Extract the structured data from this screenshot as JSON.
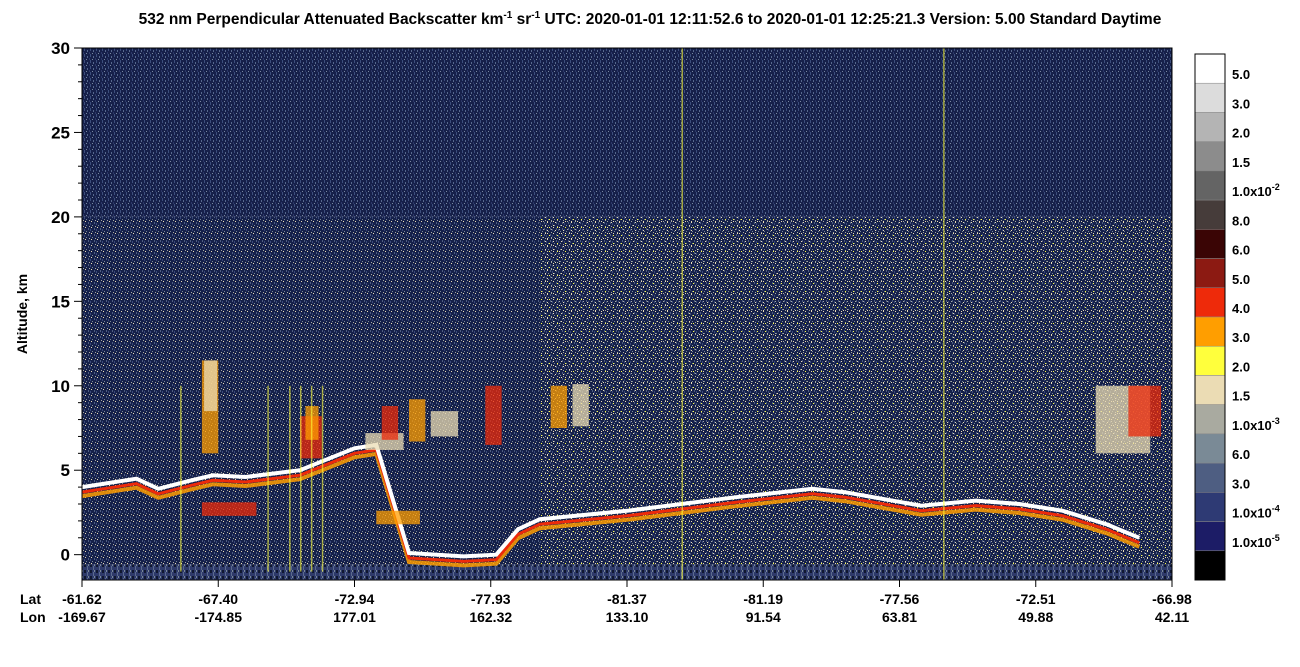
{
  "title": {
    "prefix": "532 nm Perpendicular Attenuated Backscatter km",
    "sup1": "-1",
    "middle": " sr",
    "sup2": "-1",
    "suffix": "  UTC: 2020-01-01 12:11:52.6 to 2020-01-01 12:25:21.3  Version: 5.00 Standard Daytime"
  },
  "chart_data": {
    "type": "heatmap",
    "ylabel": "Altitude, km",
    "ylim": [
      -1.5,
      30
    ],
    "y_ticks": [
      "0",
      "5",
      "10",
      "15",
      "20",
      "25",
      "30"
    ],
    "x_row_labels": [
      "Lat",
      "Lon"
    ],
    "x_ticks": [
      {
        "lat": "-61.62",
        "lon": "-169.67"
      },
      {
        "lat": "-67.40",
        "lon": "-174.85"
      },
      {
        "lat": "-72.94",
        "lon": "177.01"
      },
      {
        "lat": "-77.93",
        "lon": "162.32"
      },
      {
        "lat": "-81.37",
        "lon": "133.10"
      },
      {
        "lat": "-81.19",
        "lon": "91.54"
      },
      {
        "lat": "-77.56",
        "lon": "63.81"
      },
      {
        "lat": "-72.51",
        "lon": "49.88"
      },
      {
        "lat": "-66.98",
        "lon": "42.11"
      }
    ],
    "colorbar": [
      {
        "label": "5.0",
        "color": "#ffffff"
      },
      {
        "label": "3.0",
        "color": "#dcdcdc"
      },
      {
        "label": "2.0",
        "color": "#b4b4b4"
      },
      {
        "label": "1.5",
        "color": "#8c8c8c"
      },
      {
        "label": "1.0x10",
        "exp": "-2",
        "color": "#646464"
      },
      {
        "label": "8.0",
        "color": "#463c3a"
      },
      {
        "label": "6.0",
        "color": "#3a0505"
      },
      {
        "label": "5.0",
        "color": "#8c1a12"
      },
      {
        "label": "4.0",
        "color": "#ee2a0a"
      },
      {
        "label": "3.0",
        "color": "#ff9e00"
      },
      {
        "label": "2.0",
        "color": "#ffff3c"
      },
      {
        "label": "1.5",
        "color": "#ebdcb4"
      },
      {
        "label": "1.0x10",
        "exp": "-3",
        "color": "#a9aaa0"
      },
      {
        "label": "6.0",
        "color": "#7a8a96"
      },
      {
        "label": "3.0",
        "color": "#4e5e82"
      },
      {
        "label": "1.0x10",
        "exp": "-4",
        "color": "#2e3a74"
      },
      {
        "label": "1.0x10",
        "exp": "-5",
        "color": "#1c1c66"
      },
      {
        "label": "",
        "color": "#000000"
      }
    ],
    "surface_profile": [
      {
        "x": 0.0,
        "alt": 4.0
      },
      {
        "x": 0.05,
        "alt": 4.5
      },
      {
        "x": 0.07,
        "alt": 3.9
      },
      {
        "x": 0.1,
        "alt": 4.4
      },
      {
        "x": 0.12,
        "alt": 4.7
      },
      {
        "x": 0.15,
        "alt": 4.6
      },
      {
        "x": 0.2,
        "alt": 5.0
      },
      {
        "x": 0.25,
        "alt": 6.3
      },
      {
        "x": 0.27,
        "alt": 6.5
      },
      {
        "x": 0.3,
        "alt": 0.1
      },
      {
        "x": 0.35,
        "alt": -0.1
      },
      {
        "x": 0.38,
        "alt": 0.0
      },
      {
        "x": 0.4,
        "alt": 1.5
      },
      {
        "x": 0.42,
        "alt": 2.1
      },
      {
        "x": 0.5,
        "alt": 2.6
      },
      {
        "x": 0.6,
        "alt": 3.4
      },
      {
        "x": 0.67,
        "alt": 3.9
      },
      {
        "x": 0.7,
        "alt": 3.7
      },
      {
        "x": 0.77,
        "alt": 2.9
      },
      {
        "x": 0.82,
        "alt": 3.2
      },
      {
        "x": 0.86,
        "alt": 3.0
      },
      {
        "x": 0.9,
        "alt": 2.6
      },
      {
        "x": 0.94,
        "alt": 1.8
      },
      {
        "x": 0.97,
        "alt": 1.0
      }
    ]
  }
}
